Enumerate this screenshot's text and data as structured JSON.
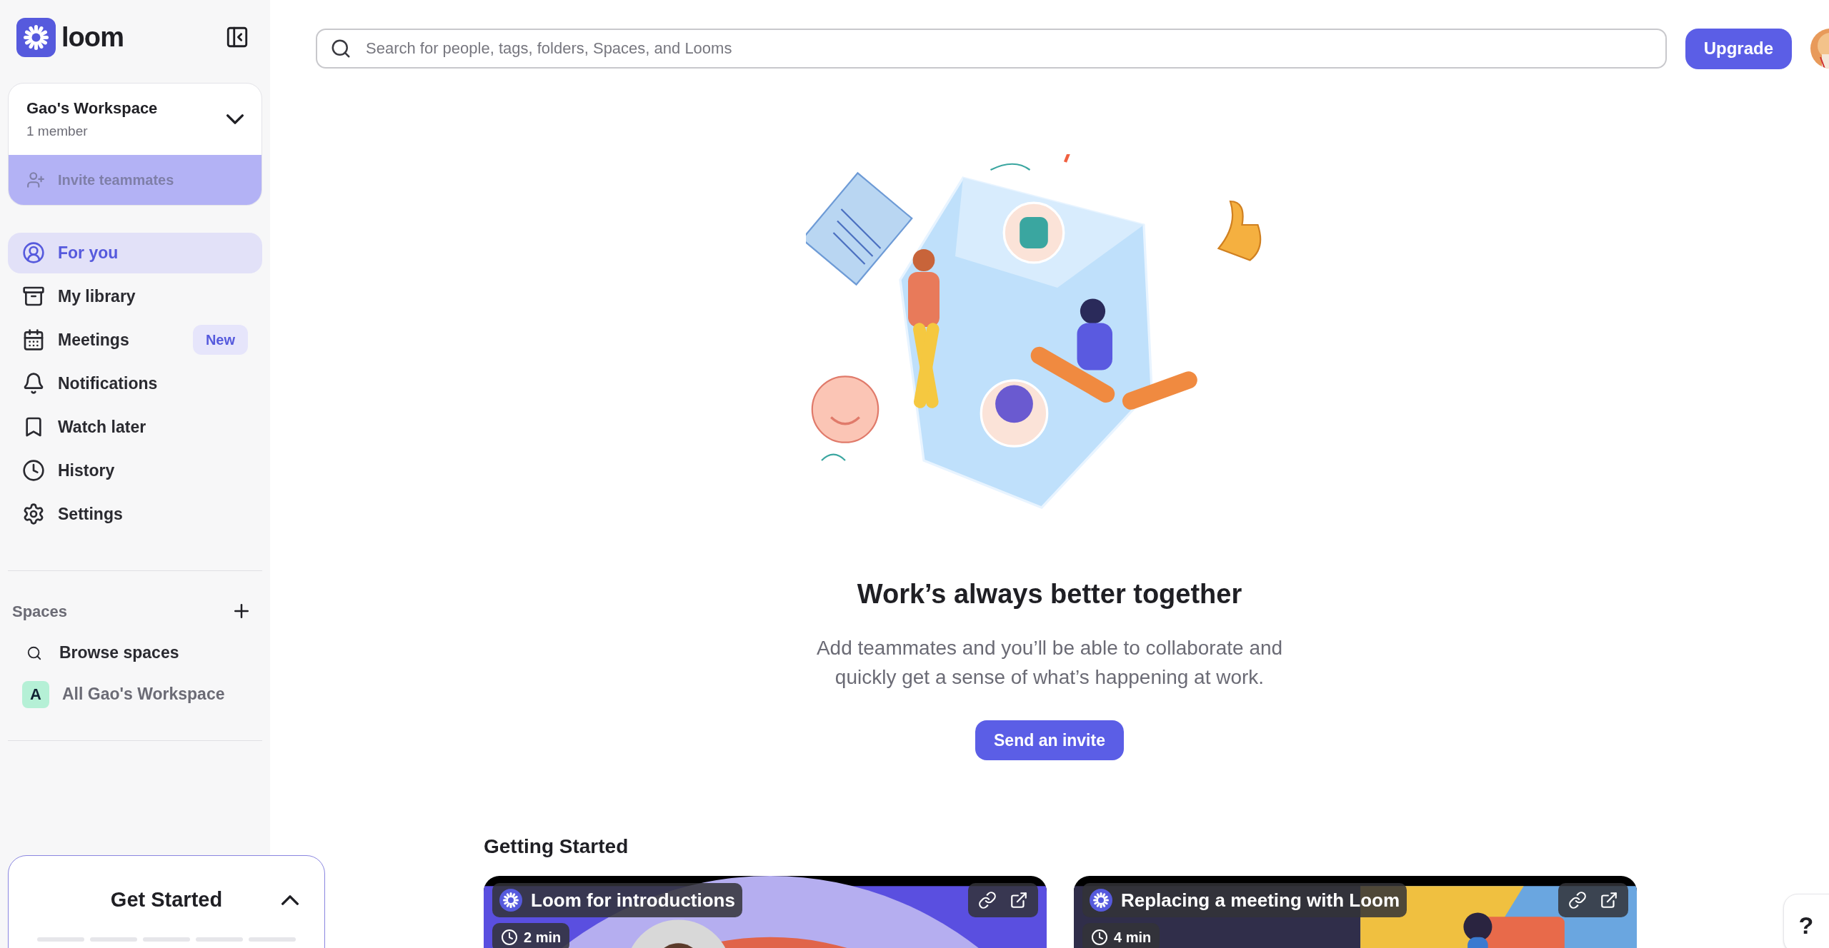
{
  "brand": {
    "name": "loom"
  },
  "workspace": {
    "name": "Gao's Workspace",
    "members": "1 member",
    "invite": "Invite teammates"
  },
  "nav": [
    {
      "label": "For you",
      "selected": true
    },
    {
      "label": "My library",
      "selected": false
    },
    {
      "label": "Meetings",
      "selected": false,
      "badge": "New"
    },
    {
      "label": "Notifications",
      "selected": false
    },
    {
      "label": "Watch later",
      "selected": false
    },
    {
      "label": "History",
      "selected": false
    },
    {
      "label": "Settings",
      "selected": false
    }
  ],
  "spaces": {
    "title": "Spaces",
    "items": [
      {
        "kind": "browse",
        "label": "Browse spaces"
      },
      {
        "kind": "space",
        "initial": "A",
        "label": "All Gao's Workspace"
      }
    ]
  },
  "get_started": {
    "title": "Get Started",
    "steps": [
      {
        "done": false
      },
      {
        "done": false
      },
      {
        "done": false
      },
      {
        "done": false
      },
      {
        "done": false
      }
    ]
  },
  "search": {
    "placeholder": "Search for people, tags, folders, Spaces, and Looms"
  },
  "upgrade": "Upgrade",
  "hero": {
    "title": "Work’s always better together",
    "text": "Add teammates and you’ll be able to collaborate and quickly get a sense of what’s happening at work.",
    "button": "Send an invite"
  },
  "getting_started": {
    "title": "Getting Started",
    "videos": [
      {
        "title": "Loom for introductions",
        "duration": "2 min",
        "kind": "picture"
      },
      {
        "title": "Replacing a meeting with Loom",
        "duration": "4 min",
        "kind": "picture"
      }
    ]
  },
  "help": "?"
}
